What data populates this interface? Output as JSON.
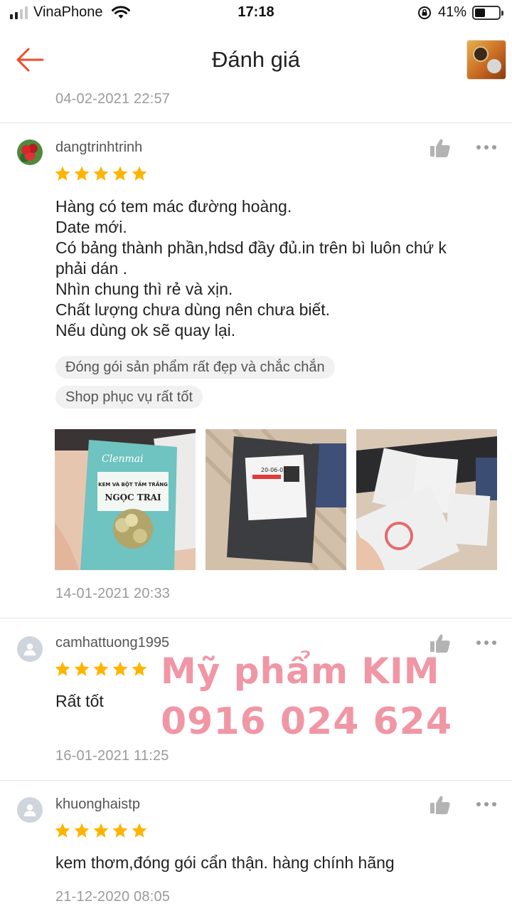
{
  "status_bar": {
    "carrier": "VinaPhone",
    "time": "17:18",
    "battery": "41%",
    "battery_level": 0.41
  },
  "header": {
    "title": "Đánh giá"
  },
  "top_date": "04-02-2021 22:57",
  "reviews": [
    {
      "username": "dangtrinhtrinh",
      "rating": 5,
      "text_lines": [
        "Hàng có tem mác đường hoàng.",
        "Date mới.",
        "Có bảng thành phần,hdsd đầy đủ.in trên bì luôn chứ k",
        "phải dán .",
        "Nhìn chung thì rẻ và xịn.",
        "Chất lượng chưa dùng nên chưa biết.",
        "Nếu dùng ok sẽ quay lại."
      ],
      "tags": [
        "Đóng gói sản phẩm rất đẹp và chắc chắn",
        "Shop phục vụ rất tốt"
      ],
      "photo_texts": {
        "brand": "Clenmai",
        "line1": "KEM VÀ BỘT TẮM TRẮNG",
        "line2": "NGỌC TRAI",
        "label_date": "20-06-01"
      },
      "date": "14-01-2021 20:33"
    },
    {
      "username": "camhattuong1995",
      "rating": 5,
      "text": "Rất tốt",
      "date": "16-01-2021 11:25"
    },
    {
      "username": "khuonghaistp",
      "rating": 5,
      "text": "kem thơm,đóng gói cẩn thận. hàng chính hãng",
      "date": "21-12-2020 08:05"
    }
  ],
  "watermark": {
    "line1": "Mỹ phẩm KIM",
    "line2": "0916 024 624"
  },
  "colors": {
    "accent": "#ee4d2d",
    "star": "#ffb400",
    "watermark": "#ec788c",
    "muted": "#9a9a9a"
  },
  "icons": [
    "back-arrow-icon",
    "thumbs-up-icon",
    "more-dots-icon",
    "star-icon",
    "user-avatar-icon",
    "wifi-icon",
    "battery-icon",
    "orientation-lock-icon"
  ]
}
